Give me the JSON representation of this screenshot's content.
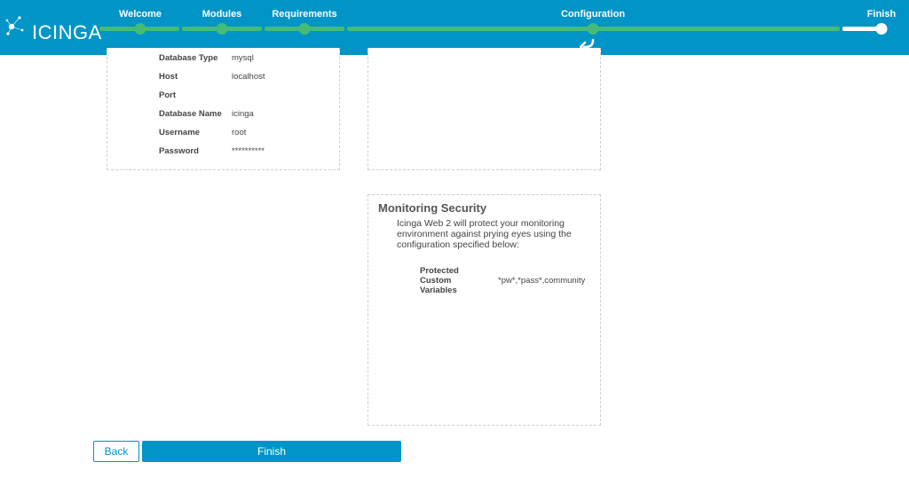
{
  "header": {
    "logo_text": "ICINGA",
    "steps": [
      {
        "label": "Welcome"
      },
      {
        "label": "Modules"
      },
      {
        "label": "Requirements"
      },
      {
        "label": "Configuration"
      },
      {
        "label": "Finish"
      }
    ],
    "colors": {
      "bar": "#0095c6",
      "progress": "#44bb77",
      "current": "#ffffff"
    },
    "return_icon": "return-arrow-icon"
  },
  "database": {
    "rows": [
      {
        "key": "Database Type",
        "value": "mysql"
      },
      {
        "key": "Host",
        "value": "localhost"
      },
      {
        "key": "Port",
        "value": ""
      },
      {
        "key": "Database Name",
        "value": "icinga"
      },
      {
        "key": "Username",
        "value": "root"
      },
      {
        "key": "Password",
        "value": "**********"
      }
    ]
  },
  "monitoring_security": {
    "title": "Monitoring Security",
    "description": "Icinga Web 2 will protect your monitoring environment against prying eyes using the configuration specified below:",
    "key": "Protected Custom Variables",
    "value": "*pw*,*pass*,community"
  },
  "buttons": {
    "back": "Back",
    "finish": "Finish"
  }
}
